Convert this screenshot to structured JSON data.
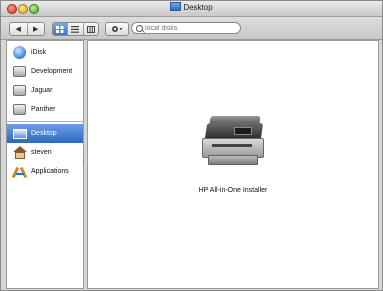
{
  "window": {
    "title": "Desktop",
    "title_icon": "desktop-folder-icon"
  },
  "toolbar": {
    "back_icon": "back-arrow-icon",
    "forward_icon": "forward-arrow-icon",
    "view_modes": [
      {
        "name": "icon-view",
        "icon": "icon-view-icon",
        "active": true
      },
      {
        "name": "list-view",
        "icon": "list-view-icon",
        "active": false
      },
      {
        "name": "column-view",
        "icon": "column-view-icon",
        "active": false
      }
    ],
    "action_icon": "gear-icon",
    "search": {
      "placeholder": "local disks",
      "value": ""
    }
  },
  "sidebar": {
    "items": [
      {
        "label": "iDisk",
        "icon": "idisk-icon"
      },
      {
        "label": "Development",
        "icon": "hard-drive-icon"
      },
      {
        "label": "Jaguar",
        "icon": "hard-drive-icon"
      },
      {
        "label": "Panther",
        "icon": "hard-drive-icon"
      },
      {
        "label": "Desktop",
        "icon": "desktop-icon",
        "selected": true
      },
      {
        "label": "steven",
        "icon": "home-icon"
      },
      {
        "label": "Applications",
        "icon": "applications-icon"
      }
    ]
  },
  "content": {
    "items": [
      {
        "label": "HP All-in-One Installer",
        "icon": "printer-icon"
      }
    ]
  },
  "colors": {
    "selection": "#3f74c8",
    "window_bg": "#d6d6d6"
  }
}
